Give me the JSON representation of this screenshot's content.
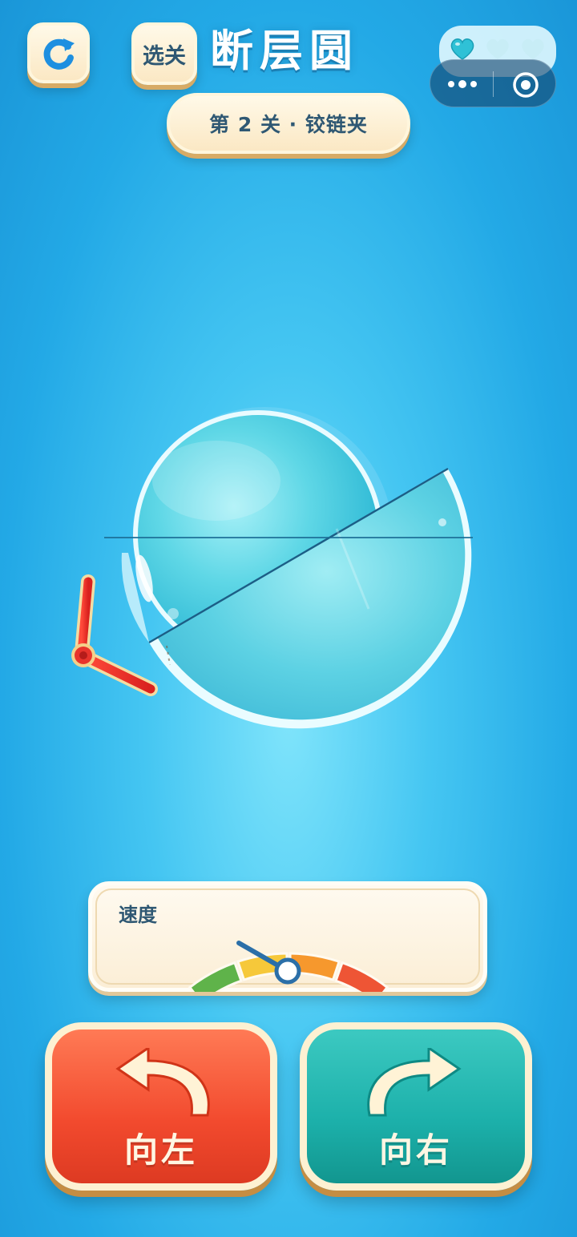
{
  "header": {
    "title": "断层圆",
    "reset_icon": "refresh-icon",
    "levels_label": "选关",
    "level_banner": "第 2 关 · 铰链夹"
  },
  "lives": {
    "total": 3,
    "remaining": 1,
    "icon": "heart-icon",
    "active_color": "#2fc1d6"
  },
  "capsule": {
    "more_icon": "more-dots-icon",
    "close_icon": "target-circle-icon"
  },
  "speed": {
    "label": "速度",
    "level_fraction": 0.32,
    "segment_colors": [
      "#5fb34a",
      "#f6c83a",
      "#f6982d",
      "#ee5535"
    ]
  },
  "controls": {
    "left_label": "向左",
    "right_label": "向右",
    "left_color": "#f24a2e",
    "right_color": "#1cb0aa"
  },
  "colors": {
    "background": "#23a9e6",
    "cream": "#fbe8c4",
    "hinge_red": "#e8342c",
    "disc": "#5fd9ea"
  }
}
